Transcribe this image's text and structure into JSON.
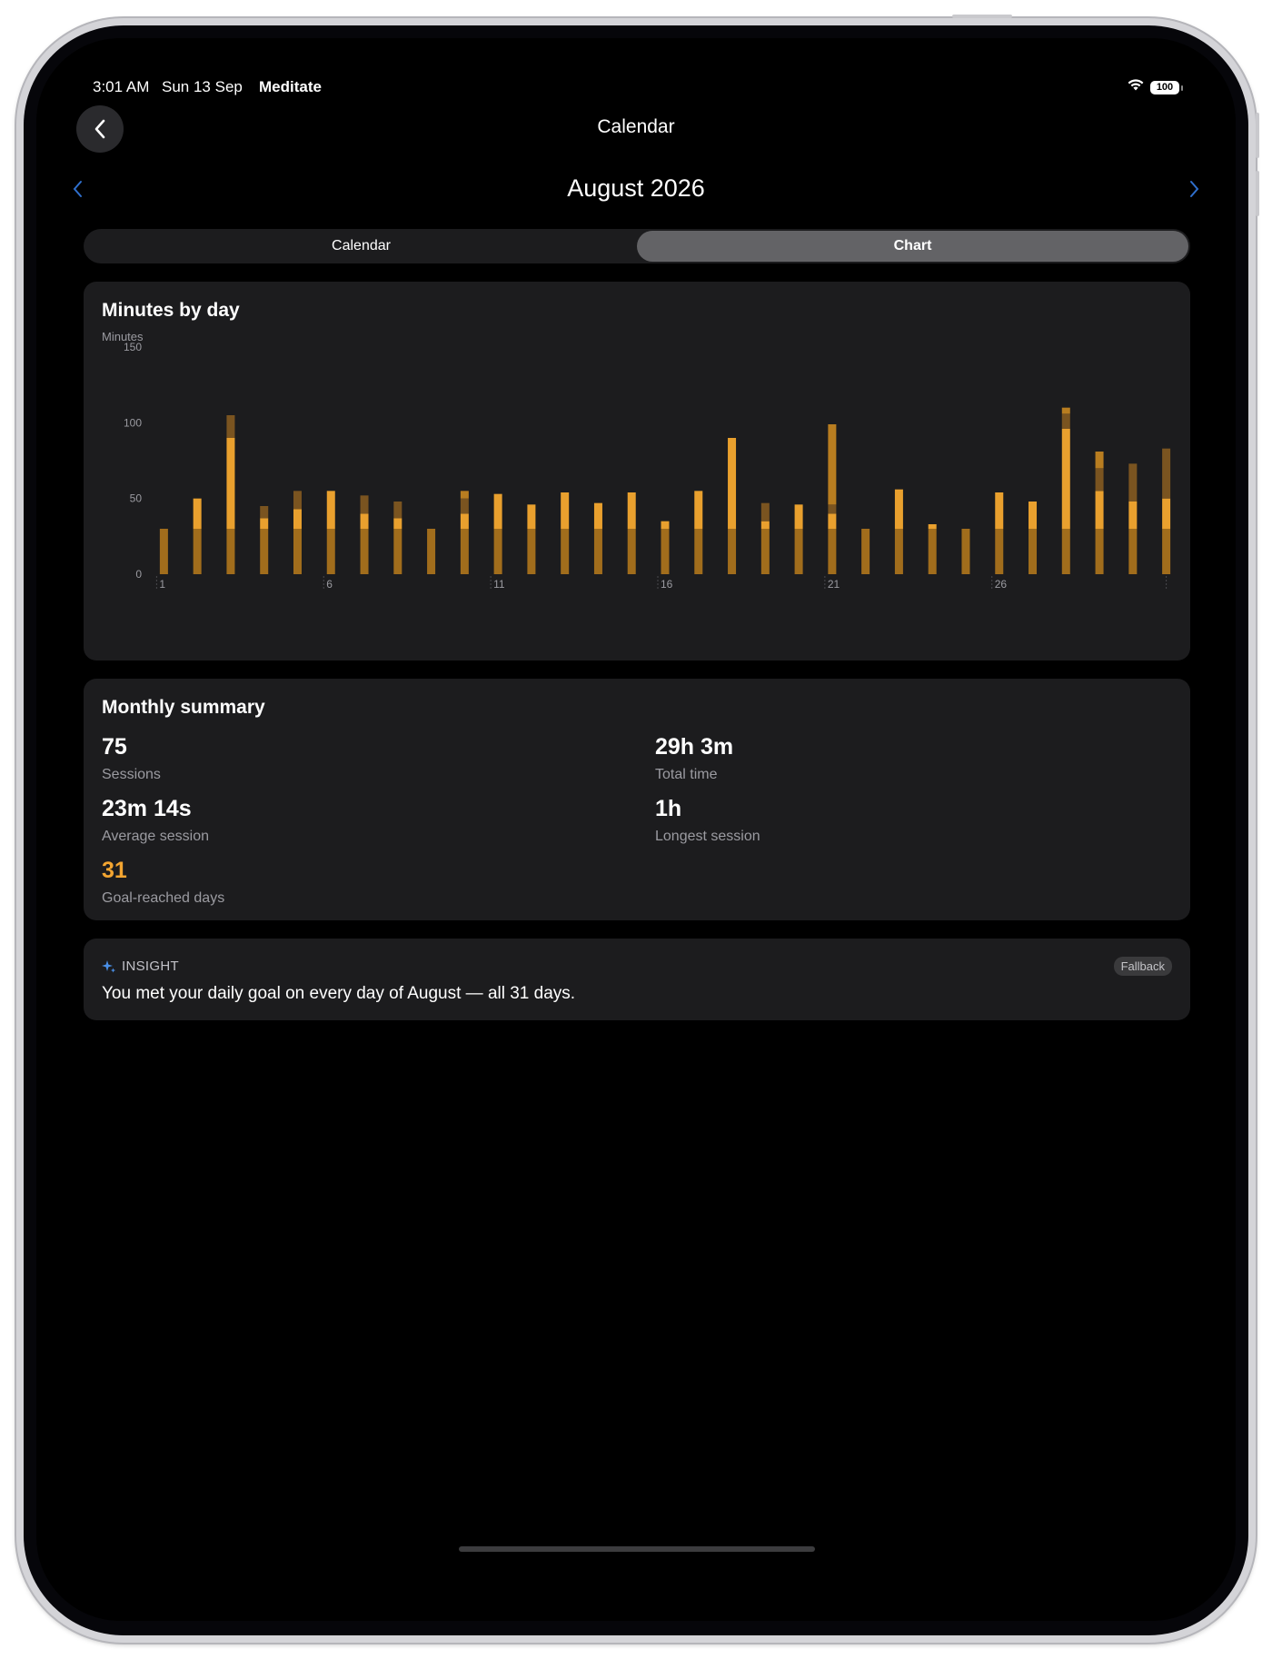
{
  "status_bar": {
    "time": "3:01 AM",
    "date": "Sun 13 Sep",
    "app": "Meditate",
    "battery": "100"
  },
  "nav": {
    "title": "Calendar"
  },
  "month": {
    "title": "August 2026"
  },
  "segments": [
    {
      "label": "Calendar",
      "selected": false
    },
    {
      "label": "Chart",
      "selected": true
    }
  ],
  "chart_card": {
    "title": "Minutes by day"
  },
  "chart_data": {
    "type": "bar",
    "stacked": true,
    "title": "Minutes by day",
    "ylabel": "Minutes",
    "ylim": [
      0,
      150
    ],
    "yticks": [
      0,
      50,
      100,
      150
    ],
    "x": [
      1,
      2,
      3,
      4,
      5,
      6,
      7,
      8,
      9,
      10,
      11,
      12,
      13,
      14,
      15,
      16,
      17,
      18,
      19,
      20,
      21,
      22,
      23,
      24,
      25,
      26,
      27,
      28,
      29,
      30,
      31
    ],
    "xtick_labels": [
      "1",
      "6",
      "11",
      "16",
      "21",
      "26"
    ],
    "xtick_values": [
      1,
      6,
      11,
      16,
      21,
      26
    ],
    "totals": [
      30,
      50,
      105,
      45,
      55,
      55,
      52,
      48,
      30,
      55,
      53,
      46,
      54,
      47,
      54,
      35,
      55,
      90,
      47,
      46,
      99,
      30,
      56,
      33,
      30,
      54,
      48,
      104,
      81,
      73,
      83
    ],
    "segment_colors": [
      "#a16d1c",
      "#e9a02e",
      "#7a5420",
      "#b87d20"
    ],
    "segments": [
      [
        30
      ],
      [
        30,
        20
      ],
      [
        30,
        60,
        15
      ],
      [
        30,
        7,
        8
      ],
      [
        30,
        13,
        12
      ],
      [
        30,
        25
      ],
      [
        30,
        10,
        12
      ],
      [
        30,
        7,
        11
      ],
      [
        30
      ],
      [
        30,
        10,
        10,
        5
      ],
      [
        30,
        23
      ],
      [
        30,
        16
      ],
      [
        30,
        24
      ],
      [
        30,
        17
      ],
      [
        30,
        24
      ],
      [
        30,
        5
      ],
      [
        30,
        25
      ],
      [
        30,
        60
      ],
      [
        30,
        5,
        12
      ],
      [
        30,
        16
      ],
      [
        30,
        10,
        6,
        53
      ],
      [
        30
      ],
      [
        30,
        26
      ],
      [
        30,
        3
      ],
      [
        30
      ],
      [
        30,
        24
      ],
      [
        30,
        18
      ],
      [
        30,
        66,
        10,
        4
      ],
      [
        30,
        25,
        15,
        11
      ],
      [
        30,
        18,
        25
      ],
      [
        30,
        20,
        33
      ]
    ]
  },
  "summary": {
    "title": "Monthly summary",
    "sessions": {
      "value": "75",
      "label": "Sessions"
    },
    "total_time": {
      "value": "29h 3m",
      "label": "Total time"
    },
    "average": {
      "value": "23m 14s",
      "label": "Average session"
    },
    "longest": {
      "value": "1h",
      "label": "Longest session"
    },
    "goal_days": {
      "value": "31",
      "label": "Goal-reached days"
    }
  },
  "insight": {
    "label": "INSIGHT",
    "badge": "Fallback",
    "text": "You met your daily goal on every day of August — all 31 days."
  },
  "colors": {
    "accent": "#f3a531",
    "link": "#2f6fcc",
    "card": "#1c1c1e"
  }
}
